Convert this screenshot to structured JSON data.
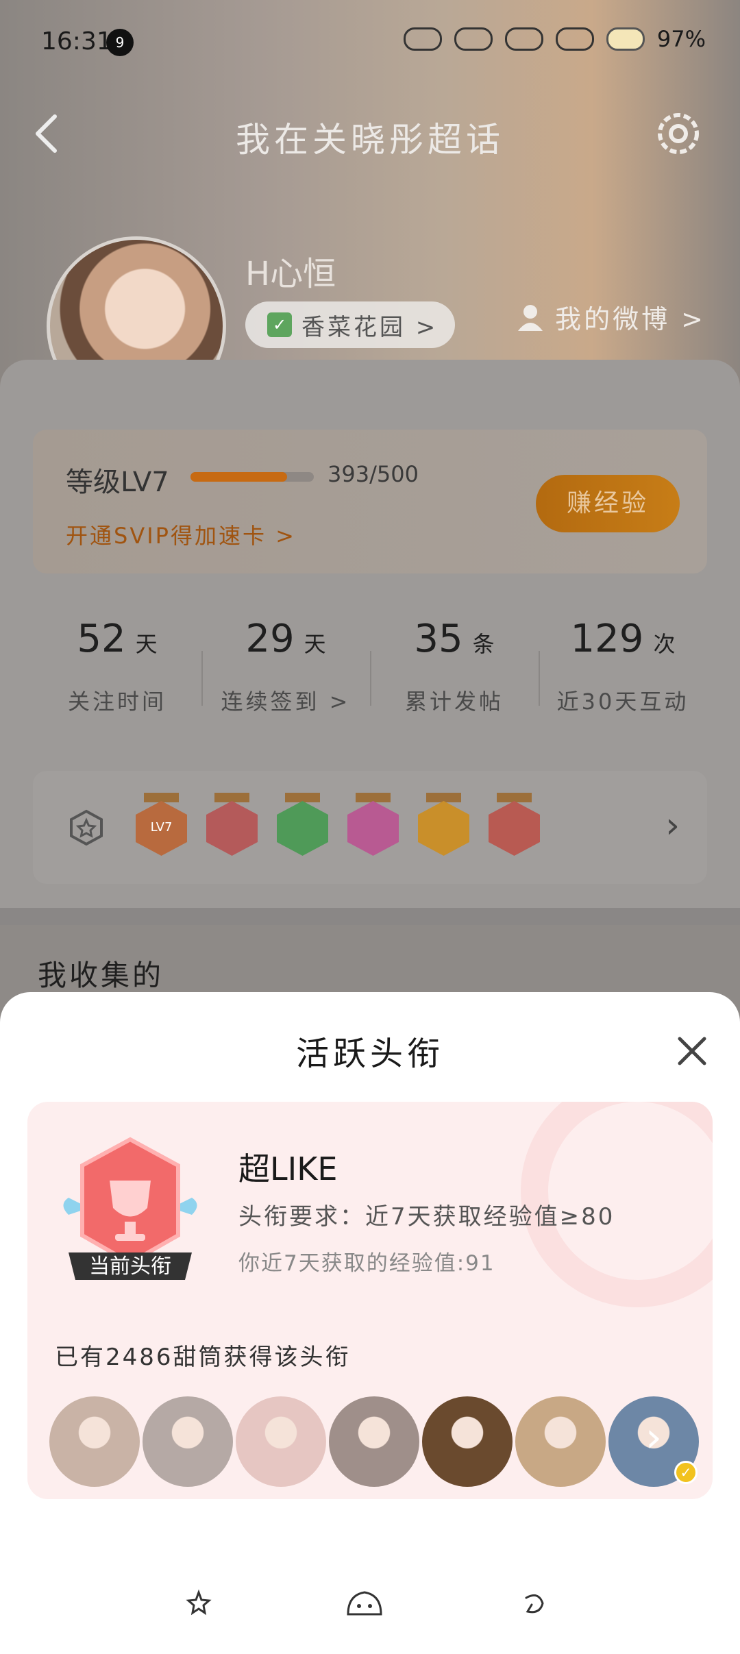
{
  "status": {
    "time": "16:31",
    "notification_count": "9",
    "battery": "97%"
  },
  "header": {
    "title": "我在关晓彤超话",
    "back_icon": "back-arrow-icon",
    "settings_icon": "gear-icon"
  },
  "profile": {
    "username": "H心恒",
    "garden_label": "香菜花园 >",
    "my_weibo_label": "我的微博 >"
  },
  "level": {
    "label": "等级LV7",
    "progress_text": "393/500",
    "progress_fraction": 0.786,
    "svip_text": "开通SVIP得加速卡 >",
    "earn_button": "赚经验",
    "accent_color": "#c76a12"
  },
  "stats": [
    {
      "value": "52",
      "unit": "天",
      "label": "关注时间"
    },
    {
      "value": "29",
      "unit": "天",
      "label": "连续签到 >"
    },
    {
      "value": "35",
      "unit": "条",
      "label": "累计发帖"
    },
    {
      "value": "129",
      "unit": "次",
      "label": "近30天互动"
    }
  ],
  "badges": [
    {
      "name": "lv7-badge",
      "text": "LV7",
      "color": "#b86a3e"
    },
    {
      "name": "trophy-badge",
      "text": "",
      "color": "#b45a5a"
    },
    {
      "name": "hand-badge",
      "text": "",
      "color": "#4f9a58"
    },
    {
      "name": "graduation-badge",
      "text": "",
      "color": "#b85a92"
    },
    {
      "name": "laugh-badge",
      "text": "",
      "color": "#c98f2a"
    },
    {
      "name": "rock-hand-badge",
      "text": "",
      "color": "#b85a52"
    }
  ],
  "collection": {
    "title": "我收集的"
  },
  "sheet": {
    "title": "活跃头衔",
    "badge_caption": "当前头衔",
    "title_name": "超LIKE",
    "requirement": "头衔要求：近7天获取经验值≥80",
    "my_value": "你近7天获取的经验值:91",
    "holders_text": "已有2486甜筒获得该头衔",
    "avatars": [
      {
        "name": "holder-avatar-1",
        "color": "#c9b3a6"
      },
      {
        "name": "holder-avatar-2",
        "color": "#b5a9a5"
      },
      {
        "name": "holder-avatar-3",
        "color": "#e6c6c2"
      },
      {
        "name": "holder-avatar-4",
        "color": "#9f8f8a"
      },
      {
        "name": "holder-avatar-5",
        "color": "#6a4a2e"
      },
      {
        "name": "holder-avatar-6",
        "color": "#c8a885"
      },
      {
        "name": "holder-avatar-more",
        "color": "#6d87a6",
        "more": true
      }
    ]
  }
}
